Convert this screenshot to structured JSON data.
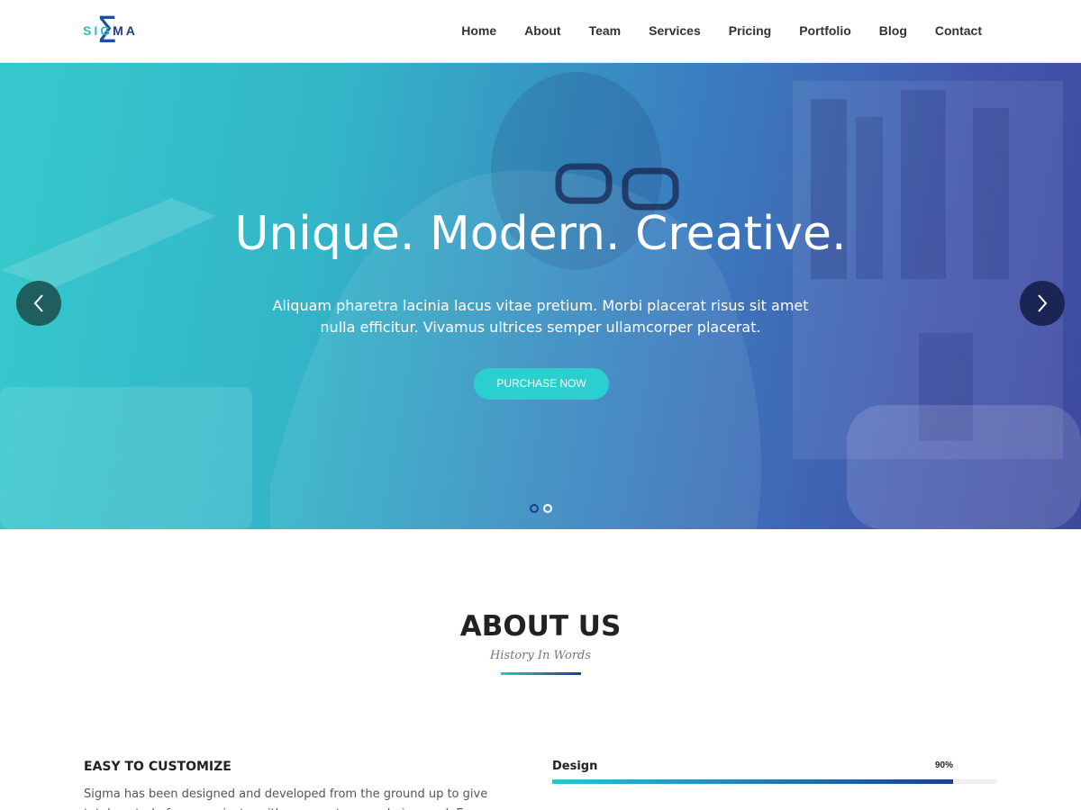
{
  "brand": {
    "name": "SIGMA",
    "accent": "#2cbcc8",
    "dark": "#1f3d8f"
  },
  "nav": {
    "items": [
      "Home",
      "About",
      "Team",
      "Services",
      "Pricing",
      "Portfolio",
      "Blog",
      "Contact"
    ]
  },
  "hero": {
    "headline": "Unique. Modern. Creative.",
    "text": "Aliquam pharetra lacinia lacus vitae pretium. Morbi placerat risus sit amet nulla efficitur. Vivamus ultrices semper ullamcorper placerat.",
    "cta_label": "PURCHASE NOW",
    "slides_total": 2,
    "active_slide": 1
  },
  "about": {
    "title": "ABOUT US",
    "subtitle": "History In Words",
    "feature_title": "EASY TO CUSTOMIZE",
    "feature_text": "Sigma has been designed and developed from the ground up to give total control of your projects, with an easy to use admin panel. Every page layout we",
    "skills": [
      {
        "label": "Design",
        "percent_label": "90%",
        "value": 0.9
      }
    ]
  }
}
